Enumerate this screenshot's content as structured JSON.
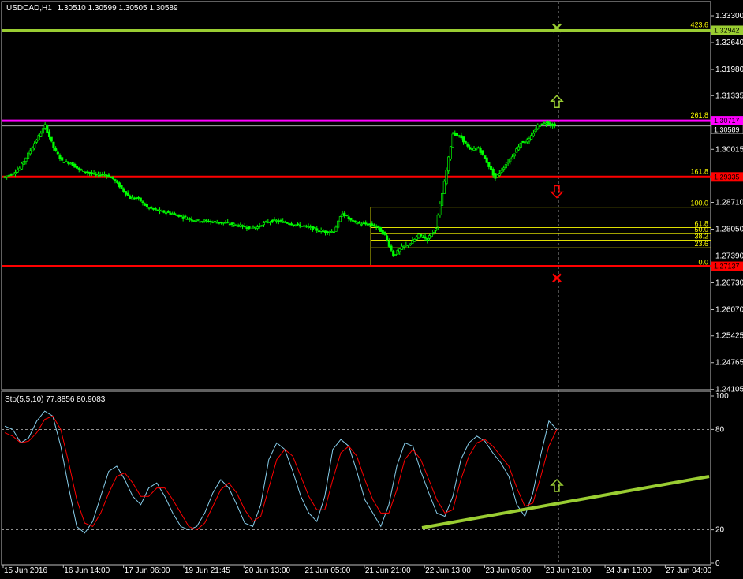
{
  "header": {
    "symbol": "USDCAD,H1",
    "ohlc": "1.30510 1.30599 1.30505 1.30589",
    "stoch_label": "Sto(5,5,10) 77.8856 80.9083"
  },
  "colors": {
    "background": "#000000",
    "candle": "#00ff00",
    "grid": "#c0c0c0",
    "fib": "#ffff00",
    "stoch_main": "#87ceeb",
    "stoch_signal": "#ff0000",
    "trend": "#9acd32"
  },
  "chart_data": {
    "type": "line",
    "price_axis": {
      "ylim": [
        1.241,
        1.3365
      ],
      "ticks": [
        "1.33300",
        "1.32640",
        "1.31980",
        "1.31335",
        "1.30015",
        "1.29355",
        "1.28710",
        "1.28050",
        "1.27390",
        "1.26730",
        "1.26070",
        "1.25425",
        "1.24765",
        "1.24105"
      ]
    },
    "time_axis": {
      "labels": [
        "15 Jun 2016",
        "16 Jun 14:00",
        "17 Jun 06:00",
        "19 Jun 21:45",
        "20 Jun 13:00",
        "21 Jun 05:00",
        "21 Jun 21:00",
        "22 Jun 13:00",
        "23 Jun 05:00",
        "23 Jun 21:00",
        "24 Jun 13:00",
        "27 Jun 04:00"
      ]
    },
    "price_series": [
      1.2932,
      1.294,
      1.2955,
      1.299,
      1.3025,
      1.306,
      1.3005,
      1.2972,
      1.2968,
      1.2951,
      1.2945,
      1.2938,
      1.294,
      1.2929,
      1.2905,
      1.2882,
      1.288,
      1.2859,
      1.2852,
      1.2847,
      1.2843,
      1.2837,
      1.283,
      1.2826,
      1.2825,
      1.2822,
      1.2821,
      1.2817,
      1.2813,
      1.2809,
      1.281,
      1.2822,
      1.2826,
      1.2823,
      1.2818,
      1.2814,
      1.281,
      1.2803,
      1.2798,
      1.28,
      1.2845,
      1.2826,
      1.2819,
      1.2817,
      1.2812,
      1.279,
      1.274,
      1.276,
      1.277,
      1.279,
      1.278,
      1.281,
      1.292,
      1.304,
      1.303,
      1.3,
      1.3005,
      1.297,
      1.293,
      1.2958,
      1.2985,
      1.3018,
      1.3025,
      1.306,
      1.3068,
      1.3059
    ],
    "horizontal_lines": [
      {
        "label": "423.6",
        "price": "1.32942",
        "color": "#9acd32"
      },
      {
        "label": "261.8",
        "price": "1.30717",
        "color": "#ff00ff"
      },
      {
        "label": "161.8",
        "price": "1.29335",
        "color": "#ff0000"
      },
      {
        "label": "0.0",
        "price": "1.27137",
        "color": "#ff0000"
      }
    ],
    "current_price": "1.30589",
    "fib_levels": [
      {
        "label": "100.0",
        "value": 1.2859
      },
      {
        "label": "61.8",
        "value": 1.2809
      },
      {
        "label": "50.0",
        "value": 1.2794
      },
      {
        "label": "38.2",
        "value": 1.2778
      },
      {
        "label": "23.6",
        "value": 1.2759
      },
      {
        "label": "0.0",
        "value": 1.2714
      }
    ],
    "stoch_axis": {
      "ylim": [
        0,
        100
      ],
      "ticks": [
        "100",
        "80",
        "20",
        "0"
      ],
      "levels": [
        80,
        20
      ]
    },
    "stoch_main": [
      82,
      80,
      72,
      75,
      85,
      91,
      88,
      70,
      45,
      22,
      18,
      25,
      40,
      55,
      58,
      50,
      40,
      35,
      45,
      48,
      40,
      30,
      22,
      20,
      22,
      30,
      42,
      50,
      45,
      35,
      24,
      22,
      35,
      62,
      72,
      68,
      55,
      40,
      30,
      25,
      40,
      68,
      74,
      70,
      55,
      38,
      30,
      22,
      35,
      58,
      72,
      70,
      55,
      42,
      30,
      28,
      40,
      62,
      72,
      76,
      73,
      66,
      60,
      52,
      35,
      28,
      42,
      65,
      85,
      80
    ],
    "stoch_signal": [
      78,
      76,
      72,
      73,
      78,
      86,
      88,
      80,
      60,
      38,
      24,
      22,
      30,
      42,
      52,
      54,
      48,
      40,
      40,
      45,
      45,
      38,
      30,
      22,
      20,
      24,
      34,
      44,
      48,
      42,
      32,
      25,
      28,
      45,
      62,
      68,
      64,
      52,
      40,
      32,
      32,
      50,
      66,
      70,
      64,
      50,
      38,
      30,
      30,
      44,
      62,
      68,
      62,
      50,
      38,
      30,
      32,
      50,
      64,
      72,
      74,
      70,
      64,
      58,
      45,
      34,
      36,
      52,
      70,
      80
    ]
  }
}
